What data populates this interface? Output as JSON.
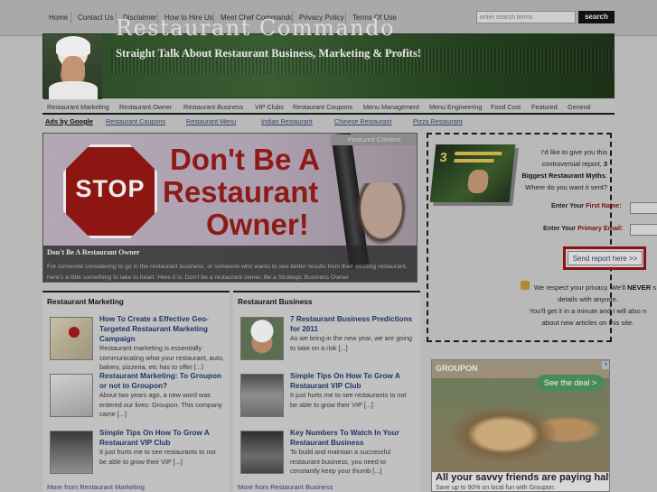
{
  "topnav": {
    "links": [
      "Home",
      "Contact Us",
      "Disclaimer",
      "How to Hire Us",
      "Meet Chef Commando",
      "Privacy Policy",
      "Terms Of Use"
    ],
    "search_placeholder": "enter search terms",
    "search_button": "search"
  },
  "header": {
    "title": "Restaurant Commando",
    "tagline": "Straight Talk About Restaurant Business, Marketing & Profits!"
  },
  "catnav": {
    "links": [
      "Restaurant Marketing",
      "Restaurant Owner",
      "Restaurant Business",
      "VIP Clubs",
      "Restaurant Coupons",
      "Menu Management",
      "Menu Engineering",
      "Food Cost",
      "Featured",
      "General"
    ]
  },
  "ads": {
    "label": "Ads by Google",
    "links": [
      "Restaurant Coupons",
      "Restaurant Menu",
      "Indian Restaurant",
      "Chinese Restaurant",
      "Pizza Restaurant"
    ]
  },
  "featured": {
    "tag": "Featured Content",
    "image_line1": "Don't Be A",
    "image_line2": "Restaurant",
    "image_line3": "Owner!",
    "stop": "STOP",
    "title": "Don't Be A Restaurant Owner",
    "desc": "For someone considering to go in the restaurant business, or someone who wants to see better results from their existing restaurant, here's a little something to take to heart. Here it is: Don't be a restaurant owner. Be a Strategic Business Owner"
  },
  "optin": {
    "book_number": "3",
    "intro_1": "I'd like to give you this",
    "intro_2": "controversial report,",
    "intro_bold_1": "3",
    "intro_bold_2": "Biggest Restaurant Myths",
    "intro_3": ".",
    "intro_4": "Where do you want it sent?",
    "first_name_label": "Enter Your ",
    "first_name_hl": "First Name",
    "first_name_colon": ":",
    "email_label": "Enter Your ",
    "email_hl": "Primary Email",
    "email_colon": ":",
    "send_button": "Send report here >>",
    "privacy_1a": "We respect your privacy. We'll ",
    "privacy_1b": "NEVER",
    "privacy_1c": " s",
    "privacy_2": "details with anyone.",
    "privacy_3": "You'll get it in a minute and I will also n",
    "privacy_4": "about new articles on this site."
  },
  "groupon": {
    "logo": "GROUPON",
    "deal_button": "See the deal >",
    "close": "x",
    "tagline": "All your savvy friends are paying half.",
    "sub": "Save up to 90% on local fun with Groupon."
  },
  "col_marketing": {
    "heading": "Restaurant Marketing",
    "posts": [
      {
        "title": "How To Create a Effective Geo-Targeted Restaurant Marketing Campaign",
        "desc": "Restaurant marketing is essentially communicating what your restaurant, auto, bakery, pizzeria, etc has to offer [...]"
      },
      {
        "title": "Restaurant Marketing: To Groupon or not to Groupon?",
        "desc": "About two years ago, a new word was entered our lives: Groupon. This company came [...]"
      },
      {
        "title": "Simple Tips On How To Grow A Restaurant VIP Club",
        "desc": "It just hurts me to see restaurants to not be able to grow their VIP [...]"
      }
    ],
    "more": "More from Restaurant Marketing"
  },
  "col_business": {
    "heading": "Restaurant Business",
    "posts": [
      {
        "title": "7 Restaurant Business Predictions for 2011",
        "desc": "As we bring in the new year, we are going to take on a risk [...]"
      },
      {
        "title": "Simple Tips On How To Grow A Restaurant VIP Club",
        "desc": "It just hurts me to see restaurants to not be able to grow their VIP [...]"
      },
      {
        "title": "Key Numbers To Watch In Your Restaurant Business",
        "desc": "To build and maintain a successful restaurant business, you need to constantly keep your thumb [...]"
      }
    ],
    "more": "More from Restaurant Business"
  }
}
